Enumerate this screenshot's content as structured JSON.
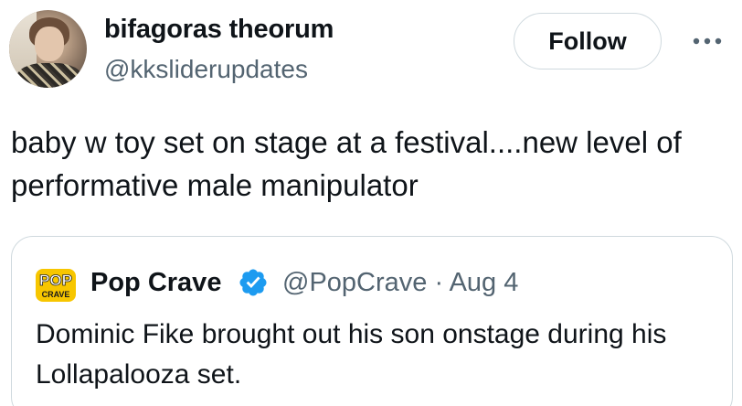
{
  "author": {
    "display_name": "bifagoras theorum",
    "handle": "@kksliderupdates"
  },
  "actions": {
    "follow_label": "Follow",
    "more_icon": "more-horizontal-icon"
  },
  "tweet": {
    "text": "baby w toy set on stage at a festival....new level of performative male manipulator"
  },
  "quoted_tweet": {
    "logo_text_top": "POP",
    "logo_text_bottom": "CRAVE",
    "display_name": "Pop Crave",
    "verified": true,
    "meta": "@PopCrave · Aug 4",
    "text": "Dominic Fike brought out his son onstage during his Lollapalooza set."
  },
  "colors": {
    "text_primary": "#0f1419",
    "text_secondary": "#536471",
    "border": "#cfd9de",
    "verified_blue": "#1d9bf0",
    "popcrave_yellow": "#f7c600"
  }
}
